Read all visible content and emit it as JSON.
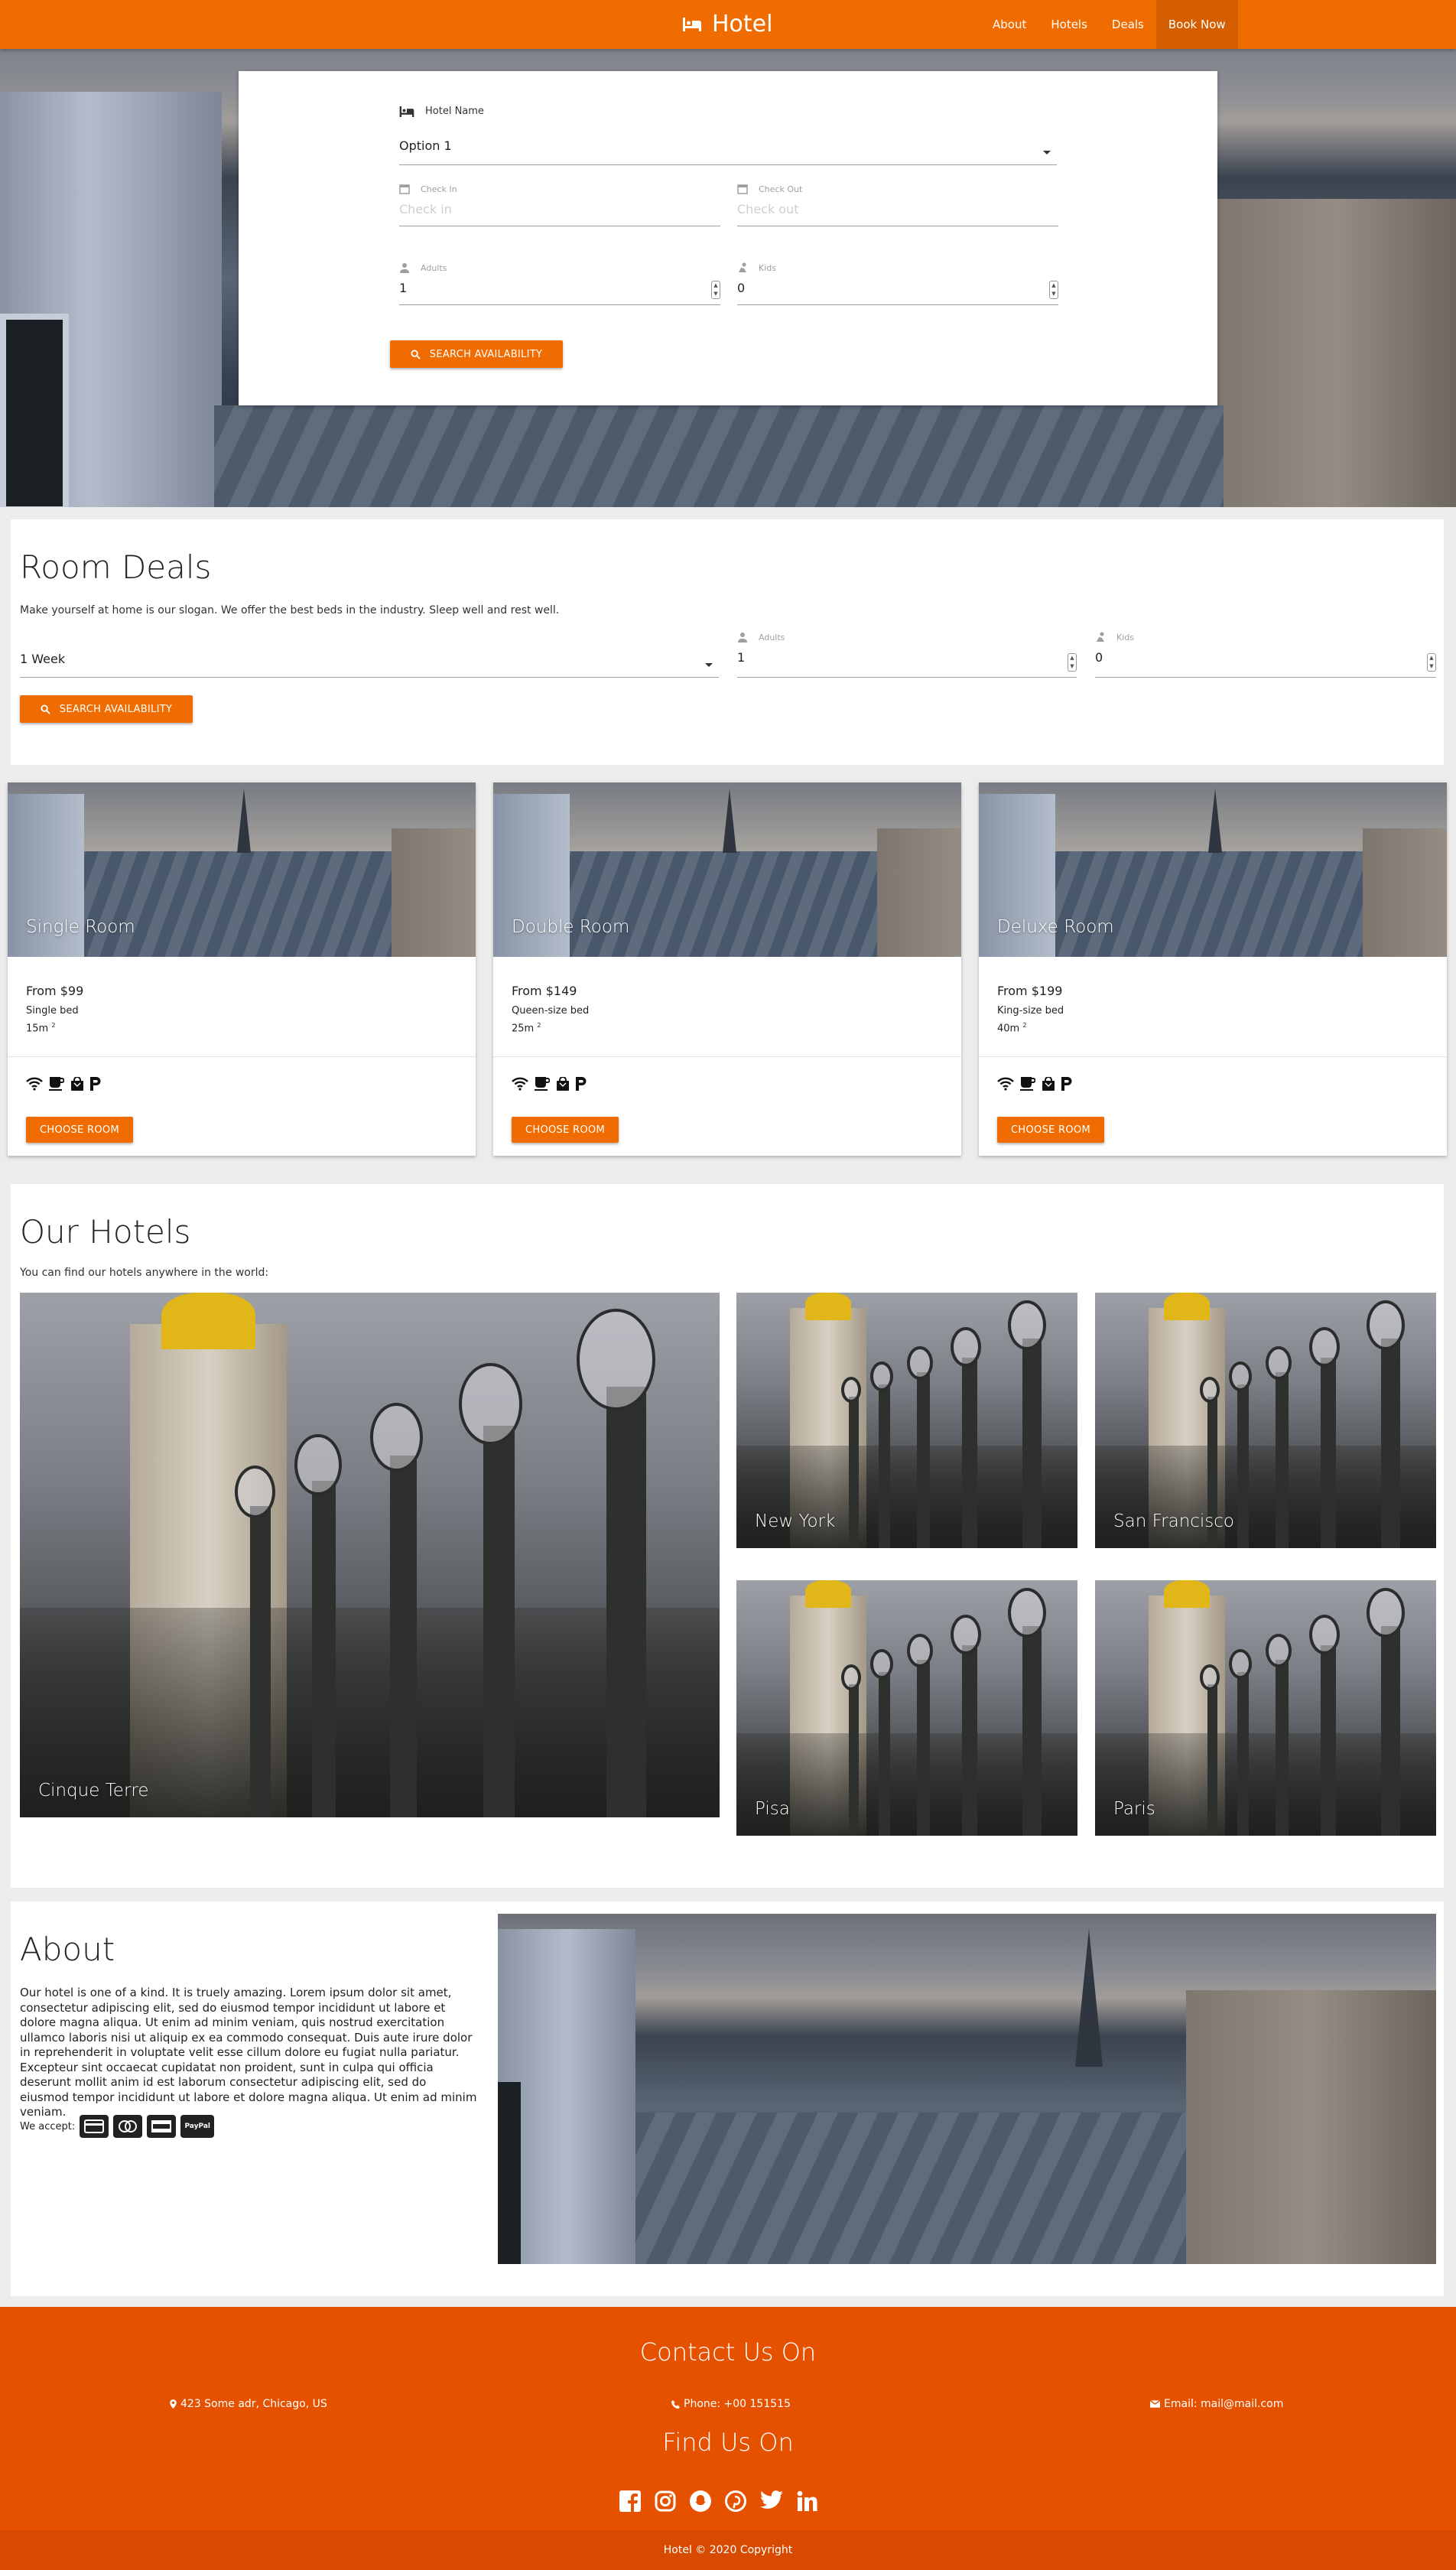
{
  "nav": {
    "brand": "Hotel",
    "links": [
      "About",
      "Hotels",
      "Deals",
      "Book Now"
    ]
  },
  "search": {
    "hotel_label": "Hotel Name",
    "hotel_value": "Option 1",
    "checkin_label": "Check In",
    "checkin_placeholder": "Check in",
    "checkout_label": "Check Out",
    "checkout_placeholder": "Check out",
    "adults_label": "Adults",
    "adults_value": "1",
    "kids_label": "Kids",
    "kids_value": "0",
    "button": "Search availability"
  },
  "deals": {
    "title": "Room Deals",
    "subtitle": "Make yourself at home is our slogan. We offer the best beds in the industry. Sleep well and rest well.",
    "duration": "1 Week",
    "adults_label": "Adults",
    "adults_value": "1",
    "kids_label": "Kids",
    "kids_value": "0",
    "button": "Search availability"
  },
  "rooms": [
    {
      "title": "Single Room",
      "price": "From $99",
      "bed": "Single bed",
      "size": "15m",
      "button": "Choose room"
    },
    {
      "title": "Double Room",
      "price": "From $149",
      "bed": "Queen-size bed",
      "size": "25m",
      "button": "Choose room"
    },
    {
      "title": "Deluxe Room",
      "price": "From $199",
      "bed": "King-size bed",
      "size": "40m",
      "button": "Choose room"
    }
  ],
  "amenity_icons": [
    "wifi-icon",
    "coffee-icon",
    "shopping-bag-icon",
    "parking-icon"
  ],
  "hotels": {
    "title": "Our Hotels",
    "subtitle": "You can find our hotels anywhere in the world:",
    "cities": [
      "Cinque Terre",
      "New York",
      "San Francisco",
      "Pisa",
      "Paris"
    ]
  },
  "about": {
    "title": "About",
    "text": "Our hotel is one of a kind. It is truely amazing. Lorem ipsum dolor sit amet, consectetur adipiscing elit, sed do eiusmod tempor incididunt ut labore et dolore magna aliqua. Ut enim ad minim veniam, quis nostrud exercitation ullamco laboris nisi ut aliquip ex ea commodo consequat. Duis aute irure dolor in reprehenderit in voluptate velit esse cillum dolore eu fugiat nulla pariatur. Excepteur sint occaecat cupidatat non proident, sunt in culpa qui officia deserunt mollit anim id est laborum consectetur adipiscing elit, sed do eiusmod tempor incididunt ut labore et dolore magna aliqua. Ut enim ad minim veniam.",
    "accept_label": "We accept:",
    "payment_icons": [
      "credit-card-icon",
      "mastercard-icon",
      "amex-icon",
      "paypal-icon"
    ],
    "paypal": "PayPal"
  },
  "footer": {
    "contact_title": "Contact Us On",
    "address": "423 Some adr, Chicago, US",
    "phone": "Phone: +00 151515",
    "email": "Email: mail@mail.com",
    "find_title": "Find Us On",
    "social_icons": [
      "facebook-icon",
      "instagram-icon",
      "snapchat-icon",
      "pinterest-icon",
      "twitter-icon",
      "linkedin-icon"
    ],
    "copyright": "Hotel © 2020 Copyright"
  },
  "colors": {
    "accent": "#f06c00",
    "footer": "#e65100",
    "footer_bottom": "#d84a00"
  }
}
